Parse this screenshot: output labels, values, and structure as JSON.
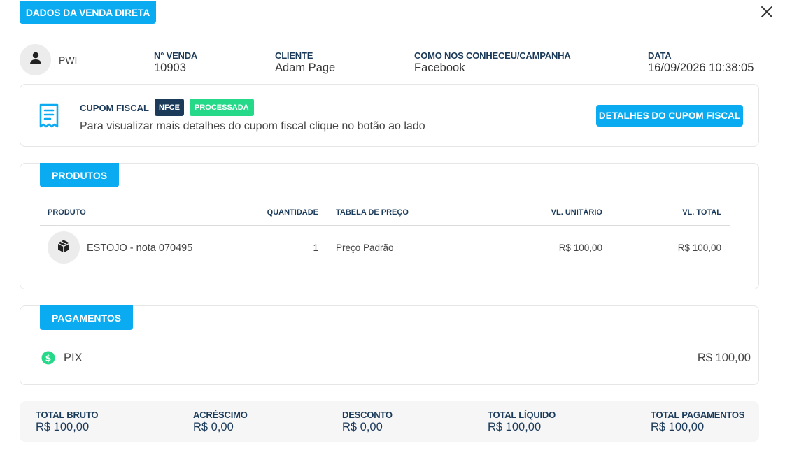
{
  "modal": {
    "title": "DADOS DA VENDA DIRETA"
  },
  "header": {
    "user": "PWI",
    "venda": {
      "label": "N° VENDA",
      "value": "10903"
    },
    "cliente": {
      "label": "CLIENTE",
      "value": "Adam Page"
    },
    "campanha": {
      "label": "COMO NOS CONHECEU/CAMPANHA",
      "value": "Facebook"
    },
    "data": {
      "label": "DATA",
      "value": "16/09/2026 10:38:05"
    }
  },
  "cupom": {
    "title": "CUPOM FISCAL",
    "badge_type": "NFCE",
    "badge_status": "PROCESSADA",
    "description": "Para visualizar mais detalhes do cupom fiscal clique no botão ao lado",
    "button_label": "DETALHES DO CUPOM FISCAL"
  },
  "produtos": {
    "section_label": "PRODUTOS",
    "columns": {
      "produto": "PRODUTO",
      "quantidade": "QUANTIDADE",
      "tabela": "TABELA DE PREÇO",
      "unitario": "VL. UNITÁRIO",
      "total": "VL. TOTAL"
    },
    "rows": [
      {
        "produto": "ESTOJO - nota 070495",
        "quantidade": "1",
        "tabela": "Preço Padrão",
        "unitario": "R$ 100,00",
        "total": "R$ 100,00"
      }
    ]
  },
  "pagamentos": {
    "section_label": "PAGAMENTOS",
    "items": [
      {
        "method": "PIX",
        "value": "R$ 100,00"
      }
    ]
  },
  "totais": {
    "bruto": {
      "label": "TOTAL BRUTO",
      "value": "R$ 100,00"
    },
    "acrescimo": {
      "label": "ACRÉSCIMO",
      "value": "R$ 0,00"
    },
    "desconto": {
      "label": "DESCONTO",
      "value": "R$ 0,00"
    },
    "liquido": {
      "label": "TOTAL LÍQUIDO",
      "value": "R$ 100,00"
    },
    "pagamentos": {
      "label": "TOTAL PAGAMENTOS",
      "value": "R$ 100,00"
    }
  },
  "colors": {
    "accent": "#0aabf0",
    "navy": "#1c3b5a",
    "success": "#25d989"
  }
}
